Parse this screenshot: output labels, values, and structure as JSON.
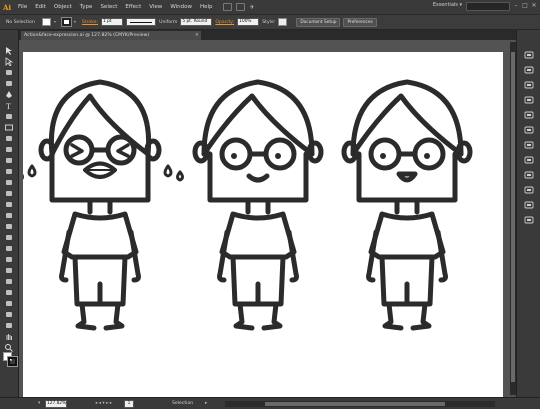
{
  "app": {
    "logo": "Ai",
    "menus": [
      "File",
      "Edit",
      "Object",
      "Type",
      "Select",
      "Effect",
      "View",
      "Window",
      "Help"
    ],
    "workspace": "Essentials",
    "workspace_caret": "▾",
    "search_placeholder": "",
    "window_controls": [
      "–",
      "□",
      "✕"
    ]
  },
  "control_bar": {
    "selection_label": "No Selection",
    "stroke_label": "Stroke:",
    "stroke_weight": "1 pt",
    "profile_label": "Uniform",
    "brush_label": "5 pt. Round",
    "opacity_label": "Opacity:",
    "opacity_value": "100%",
    "style_label": "Style:",
    "document_setup_button": "Document Setup",
    "preferences_button": "Preferences"
  },
  "tab": {
    "title": "Action&face-expression.ai @ 127.82% (CMYK/Preview)",
    "close": "×"
  },
  "status_bar": {
    "zoom": "127.82%",
    "artboard_nav": "◂ ◂  ▾  ▸ ▸",
    "artboard_number": "1",
    "tool": "Selection",
    "tool_caret": "▸"
  },
  "icons": {
    "toolbox": [
      "selection-tool-icon",
      "direct-selection-tool-icon",
      "magic-wand-tool-icon",
      "lasso-tool-icon",
      "pen-tool-icon",
      "type-tool-icon",
      "line-segment-tool-icon",
      "rectangle-tool-icon",
      "paintbrush-tool-icon",
      "pencil-tool-icon",
      "blob-brush-tool-icon",
      "eraser-tool-icon",
      "rotate-tool-icon",
      "scale-tool-icon",
      "width-tool-icon",
      "free-transform-tool-icon",
      "shape-builder-tool-icon",
      "perspective-grid-tool-icon",
      "mesh-tool-icon",
      "gradient-tool-icon",
      "eyedropper-tool-icon",
      "blend-tool-icon",
      "symbol-sprayer-tool-icon",
      "column-graph-tool-icon",
      "artboard-tool-icon",
      "slice-tool-icon",
      "hand-tool-icon",
      "zoom-tool-icon"
    ],
    "dock": [
      "color-panel-icon",
      "color-guide-panel-icon",
      "swatches-panel-icon",
      "brushes-panel-icon",
      "symbols-panel-icon",
      "stroke-panel-icon",
      "gradient-panel-icon",
      "transparency-panel-icon",
      "appearance-panel-icon",
      "graphic-styles-panel-icon",
      "layers-panel-icon",
      "artboards-panel-icon"
    ]
  },
  "colors": {
    "accent": "#e8912e",
    "logo": "#f29a1e",
    "chrome": "#3a3a3a",
    "pasteboard": "#535353",
    "artboard": "#ffffff",
    "ink": "#2b2b2b"
  }
}
